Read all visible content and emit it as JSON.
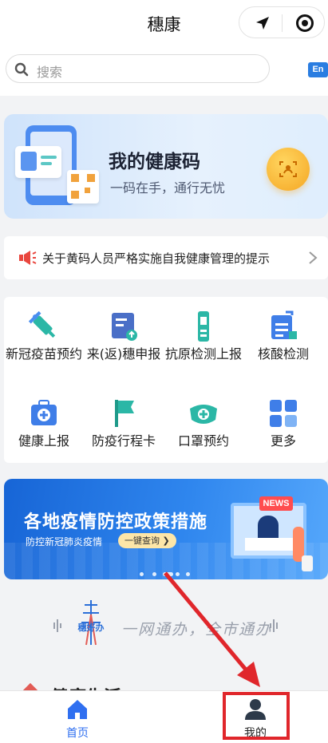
{
  "header": {
    "title": "穗康"
  },
  "search": {
    "placeholder": "搜索",
    "lang_button": "En"
  },
  "health_code": {
    "title": "我的健康码",
    "subtitle": "一码在手，通行无忧"
  },
  "notice": {
    "text": "关于黄码人员严格实施自我健康管理的提示"
  },
  "services": [
    {
      "label": "新冠疫苗预约",
      "icon": "vaccine-syringe-icon"
    },
    {
      "label": "来(返)穗申报",
      "icon": "declaration-form-icon"
    },
    {
      "label": "抗原检测上报",
      "icon": "antigen-test-icon"
    },
    {
      "label": "核酸检测",
      "icon": "nucleic-acid-test-icon"
    },
    {
      "label": "健康上报",
      "icon": "medical-kit-icon"
    },
    {
      "label": "防疫行程卡",
      "icon": "flag-itinerary-icon"
    },
    {
      "label": "口罩预约",
      "icon": "mask-icon"
    },
    {
      "label": "更多",
      "icon": "grid-more-icon"
    }
  ],
  "banner": {
    "title": "各地疫情防控政策措施",
    "subtitle": "防控新冠肺炎疫情",
    "query_button": "一键查询 ❯",
    "news_tag": "NEWS"
  },
  "slogan": {
    "logo_text": "穗好办",
    "text": "一网通办，全市通办"
  },
  "section_peek": {
    "title": "健康生活"
  },
  "tabbar": {
    "items": [
      {
        "label": "首页",
        "active": true
      },
      {
        "label": "我的",
        "active": false
      }
    ]
  },
  "colors": {
    "accent": "#2f6ff0",
    "highlight_red": "#e0262b",
    "code_yellow": "#f5a623"
  }
}
